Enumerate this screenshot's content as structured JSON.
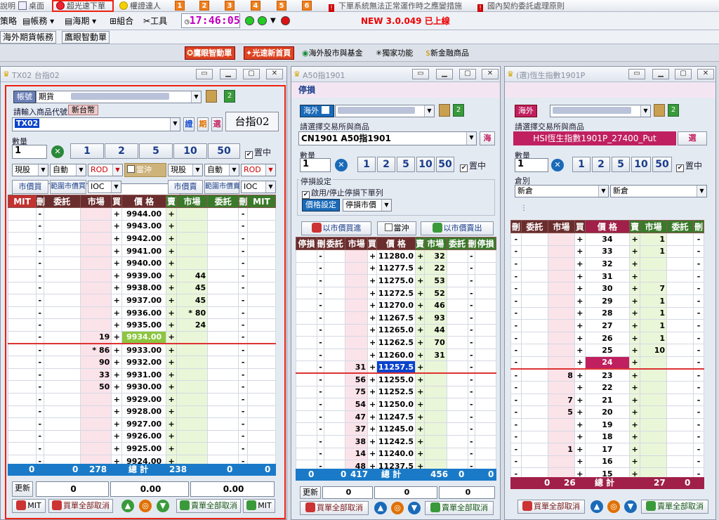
{
  "toolbar": {
    "row1": {
      "help": "說明",
      "desktop": "桌面",
      "fast_order": "超光速下單",
      "master": "權證達人",
      "nums": [
        "1",
        "2",
        "3",
        "4",
        "5",
        "6"
      ],
      "notice1": "下單系統無法正常運作時之應變措施",
      "notice2": "國內契約委託處理原則"
    },
    "row2": {
      "strategy": "策略",
      "account": "帳務",
      "futures": "海期",
      "combo": "組合",
      "tools": "工具",
      "clock": "17:46:05",
      "version": "NEW 3.0.049 已上線"
    },
    "row3": {
      "tab1": "海外期貨帳務",
      "tab2": "鷹眼智動單",
      "btn_eagle": "鷹眼智動單",
      "btn_fast_home": "光速新首頁",
      "btn_overseas": "海外股市與基金",
      "btn_exclusive": "獨家功能",
      "btn_fintech": "新金融商品"
    }
  },
  "panel1": {
    "title": "TX02 台指02",
    "account_btn": "帳號",
    "account_type": "期貨",
    "input_label": "請輸入商品代號",
    "currency": "新台幣",
    "symbol": "TX02",
    "btn_cert": "證",
    "btn_fut": "期",
    "btn_opt": "選",
    "product_name": "台指02",
    "qty_label": "數量",
    "qty": "1",
    "qty_btns": [
      "1",
      "2",
      "5",
      "10",
      "50"
    ],
    "center_label": "置中",
    "sel_left": [
      "現股",
      "自動",
      "ROD"
    ],
    "offset_label": "當沖",
    "sel_right": [
      "現股",
      "自動",
      "ROD"
    ],
    "mkt_buy": "市價買",
    "range_buy": "範圍市價買",
    "ioc_left": "IOC",
    "mkt_sell": "市價賣",
    "range_sell": "範圍市價賣",
    "ioc_right": "IOC",
    "headers": [
      "MIT",
      "刪",
      "委託",
      "市場",
      "買",
      "價 格",
      "賣",
      "市場",
      "委託",
      "刪",
      "MIT"
    ],
    "rows": [
      {
        "bq": "",
        "price": "9944.00",
        "sq": ""
      },
      {
        "bq": "",
        "price": "9943.00",
        "sq": ""
      },
      {
        "bq": "",
        "price": "9942.00",
        "sq": ""
      },
      {
        "bq": "",
        "price": "9941.00",
        "sq": ""
      },
      {
        "bq": "",
        "price": "9940.00",
        "sq": ""
      },
      {
        "bq": "",
        "price": "9939.00",
        "sq": "44"
      },
      {
        "bq": "",
        "price": "9938.00",
        "sq": "45"
      },
      {
        "bq": "",
        "price": "9937.00",
        "sq": "45"
      },
      {
        "bq": "",
        "price": "9936.00",
        "sq": "* 80"
      },
      {
        "bq": "",
        "price": "9935.00",
        "sq": "24"
      },
      {
        "bq": "19",
        "price": "9934.00",
        "sq": ""
      },
      {
        "bq": "* 86",
        "price": "9933.00",
        "sq": ""
      },
      {
        "bq": "90",
        "price": "9932.00",
        "sq": ""
      },
      {
        "bq": "33",
        "price": "9931.00",
        "sq": ""
      },
      {
        "bq": "50",
        "price": "9930.00",
        "sq": ""
      },
      {
        "bq": "",
        "price": "9929.00",
        "sq": ""
      },
      {
        "bq": "",
        "price": "9928.00",
        "sq": ""
      },
      {
        "bq": "",
        "price": "9927.00",
        "sq": ""
      },
      {
        "bq": "",
        "price": "9926.00",
        "sq": ""
      },
      {
        "bq": "",
        "price": "9925.00",
        "sq": ""
      },
      {
        "bq": "",
        "price": "9924.00",
        "sq": ""
      }
    ],
    "highlight_price": "9934.00",
    "sum": {
      "a": "0",
      "b": "0",
      "c": "278",
      "label": "總 計",
      "d": "238",
      "e": "0",
      "f": "0"
    },
    "refresh": "更新",
    "foot_vals": [
      "0",
      "0.00",
      "0.00"
    ],
    "foot_mit_left": "MIT",
    "foot_buy_cancel": "買單全部取消",
    "foot_sell_cancel": "賣單全部取消",
    "foot_mit_right": "MIT"
  },
  "panel2": {
    "title": "A50指1901",
    "tab": "停損",
    "market": "海外",
    "exch_label": "請選擇交易所與商品",
    "product": "CN1901 A50指1901",
    "sea_btn": "海",
    "qty_label": "數量",
    "qty": "1",
    "qty_btns": [
      "1",
      "2",
      "5",
      "10",
      "50"
    ],
    "center_label": "置中",
    "stop_section": "停損設定",
    "stop_enable": "啟用/停止停損下單列",
    "price_set": "價格設定",
    "stop_type": "停損市價",
    "mkt_buy": "以市價買進",
    "offset": "當沖",
    "mkt_sell": "以市價賣出",
    "headers": [
      "停損",
      "刪",
      "委託",
      "市場",
      "買",
      "價 格",
      "賣",
      "市場",
      "委託",
      "刪",
      "停損"
    ],
    "rows": [
      {
        "bq": "",
        "price": "11280.0",
        "sq": "32"
      },
      {
        "bq": "",
        "price": "11277.5",
        "sq": "22"
      },
      {
        "bq": "",
        "price": "11275.0",
        "sq": "53"
      },
      {
        "bq": "",
        "price": "11272.5",
        "sq": "52"
      },
      {
        "bq": "",
        "price": "11270.0",
        "sq": "46"
      },
      {
        "bq": "",
        "price": "11267.5",
        "sq": "93"
      },
      {
        "bq": "",
        "price": "11265.0",
        "sq": "44"
      },
      {
        "bq": "",
        "price": "11262.5",
        "sq": "70"
      },
      {
        "bq": "",
        "price": "11260.0",
        "sq": "31"
      },
      {
        "bq": "31",
        "price": "11257.5",
        "sq": ""
      },
      {
        "bq": "56",
        "price": "11255.0",
        "sq": ""
      },
      {
        "bq": "75",
        "price": "11252.5",
        "sq": ""
      },
      {
        "bq": "54",
        "price": "11250.0",
        "sq": ""
      },
      {
        "bq": "47",
        "price": "11247.5",
        "sq": ""
      },
      {
        "bq": "37",
        "price": "11245.0",
        "sq": ""
      },
      {
        "bq": "38",
        "price": "11242.5",
        "sq": ""
      },
      {
        "bq": "14",
        "price": "11240.0",
        "sq": ""
      },
      {
        "bq": "48",
        "price": "11237.5",
        "sq": ""
      }
    ],
    "highlight_price": "11257.5",
    "sum": {
      "a": "0",
      "b": "0",
      "c": "417",
      "label": "總 計",
      "d": "456",
      "e": "0",
      "f": "0"
    },
    "refresh": "更新",
    "foot_vals": [
      "0",
      "0",
      "0"
    ],
    "foot_buy_cancel": "買單全部取消",
    "foot_sell_cancel": "賣單全部取消"
  },
  "panel3": {
    "title": "(選)恆生指數1901P",
    "market": "海外",
    "exch_label": "請選擇交易所與商品",
    "product": "HSI恆生指數1901P_27400_Put",
    "opt_btn": "選",
    "qty_label": "數量",
    "qty": "1",
    "qty_btns": [
      "1",
      "2",
      "5",
      "10",
      "50"
    ],
    "center_label": "置中",
    "pos_label": "倉別",
    "pos_left": "新倉",
    "pos_right": "新倉",
    "headers": [
      "刪",
      "委託",
      "市場",
      "買",
      "價 格",
      "賣",
      "市場",
      "委託",
      "刪"
    ],
    "rows": [
      {
        "bq": "",
        "price": "34",
        "sq": "1"
      },
      {
        "bq": "",
        "price": "33",
        "sq": "1"
      },
      {
        "bq": "",
        "price": "32",
        "sq": ""
      },
      {
        "bq": "",
        "price": "31",
        "sq": ""
      },
      {
        "bq": "",
        "price": "30",
        "sq": "7"
      },
      {
        "bq": "",
        "price": "29",
        "sq": "1"
      },
      {
        "bq": "",
        "price": "28",
        "sq": "1"
      },
      {
        "bq": "",
        "price": "27",
        "sq": "1"
      },
      {
        "bq": "",
        "price": "26",
        "sq": "1"
      },
      {
        "bq": "",
        "price": "25",
        "sq": "10"
      },
      {
        "bq": "",
        "price": "24",
        "sq": ""
      },
      {
        "bq": "8",
        "price": "23",
        "sq": ""
      },
      {
        "bq": "",
        "price": "22",
        "sq": ""
      },
      {
        "bq": "7",
        "price": "21",
        "sq": ""
      },
      {
        "bq": "5",
        "price": "20",
        "sq": ""
      },
      {
        "bq": "",
        "price": "19",
        "sq": ""
      },
      {
        "bq": "",
        "price": "18",
        "sq": ""
      },
      {
        "bq": "1",
        "price": "17",
        "sq": ""
      },
      {
        "bq": "",
        "price": "16",
        "sq": ""
      },
      {
        "bq": "",
        "price": "15",
        "sq": ""
      }
    ],
    "highlight_price": "24",
    "sum": {
      "a": "0",
      "b": "26",
      "label": "總 計",
      "c": "27",
      "d": "0"
    },
    "foot_buy_cancel": "買單全部取消",
    "foot_sell_cancel": "賣單全部取消"
  }
}
